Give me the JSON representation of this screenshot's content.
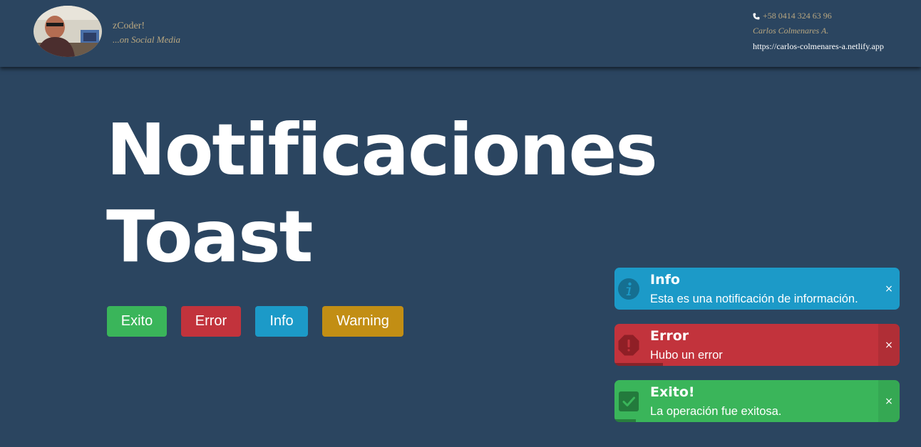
{
  "header": {
    "brand_name": "zCoder!",
    "brand_tagline": "...on Social Media",
    "phone": "+58 0414 324 63 96",
    "author": "Carlos Colmenares A.",
    "site_url": "https://carlos-colmenares-a.netlify.app"
  },
  "hero": {
    "line1": "Notificaciones",
    "line2": "Toast"
  },
  "buttons": {
    "exito": "Exito",
    "error": "Error",
    "info": "Info",
    "warning": "Warning"
  },
  "toasts": [
    {
      "type": "info",
      "icon": "info-icon",
      "title": "Info",
      "message": "Esta es una notificación de información.",
      "close": "×",
      "color": "#1c9ac8"
    },
    {
      "type": "error",
      "icon": "error-icon",
      "title": "Error",
      "message": "Hubo un error",
      "close": "×",
      "color": "#c2333c",
      "progress": 0.17
    },
    {
      "type": "exito",
      "icon": "check-icon",
      "title": "Exito!",
      "message": "La operación fue exitosa.",
      "close": "×",
      "color": "#3ab55a",
      "progress": 0.075
    }
  ],
  "colors": {
    "background": "#2b4560",
    "accent_text": "#b9a780",
    "success": "#3ab55a",
    "danger": "#c2333c",
    "info": "#1c9ac8",
    "warning": "#c28e14"
  }
}
